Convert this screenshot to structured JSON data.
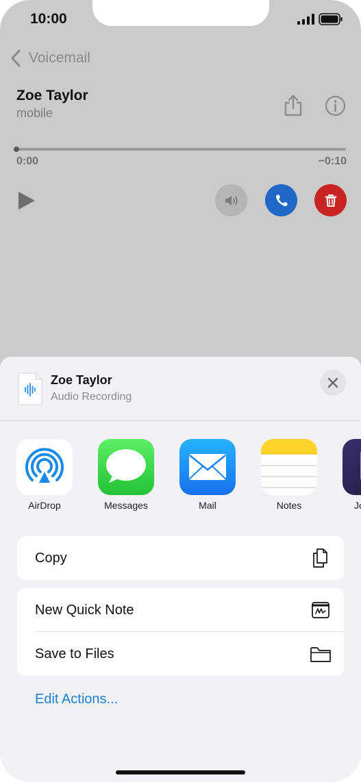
{
  "status_bar": {
    "time": "10:00"
  },
  "nav": {
    "back_label": "Voicemail"
  },
  "voicemail": {
    "name": "Zoe Taylor",
    "type": "mobile",
    "elapsed": "0:00",
    "remaining": "−0:10",
    "progress": 0
  },
  "share_sheet": {
    "title": "Zoe Taylor",
    "subtitle": "Audio Recording",
    "apps": [
      {
        "label": "AirDrop",
        "icon": "airdrop-icon"
      },
      {
        "label": "Messages",
        "icon": "messages-icon"
      },
      {
        "label": "Mail",
        "icon": "mail-icon"
      },
      {
        "label": "Notes",
        "icon": "notes-icon"
      },
      {
        "label": "Jo",
        "icon": "journal-icon"
      }
    ],
    "actions_group_1": [
      {
        "label": "Copy",
        "icon": "copy-icon"
      }
    ],
    "actions_group_2": [
      {
        "label": "New Quick Note",
        "icon": "quick-note-icon"
      },
      {
        "label": "Save to Files",
        "icon": "folder-icon"
      }
    ],
    "edit_actions": "Edit Actions..."
  },
  "colors": {
    "accent": "#1b7fd6",
    "call": "#1f68c7",
    "delete": "#c92424",
    "sheet_bg": "#f2f2f6"
  }
}
